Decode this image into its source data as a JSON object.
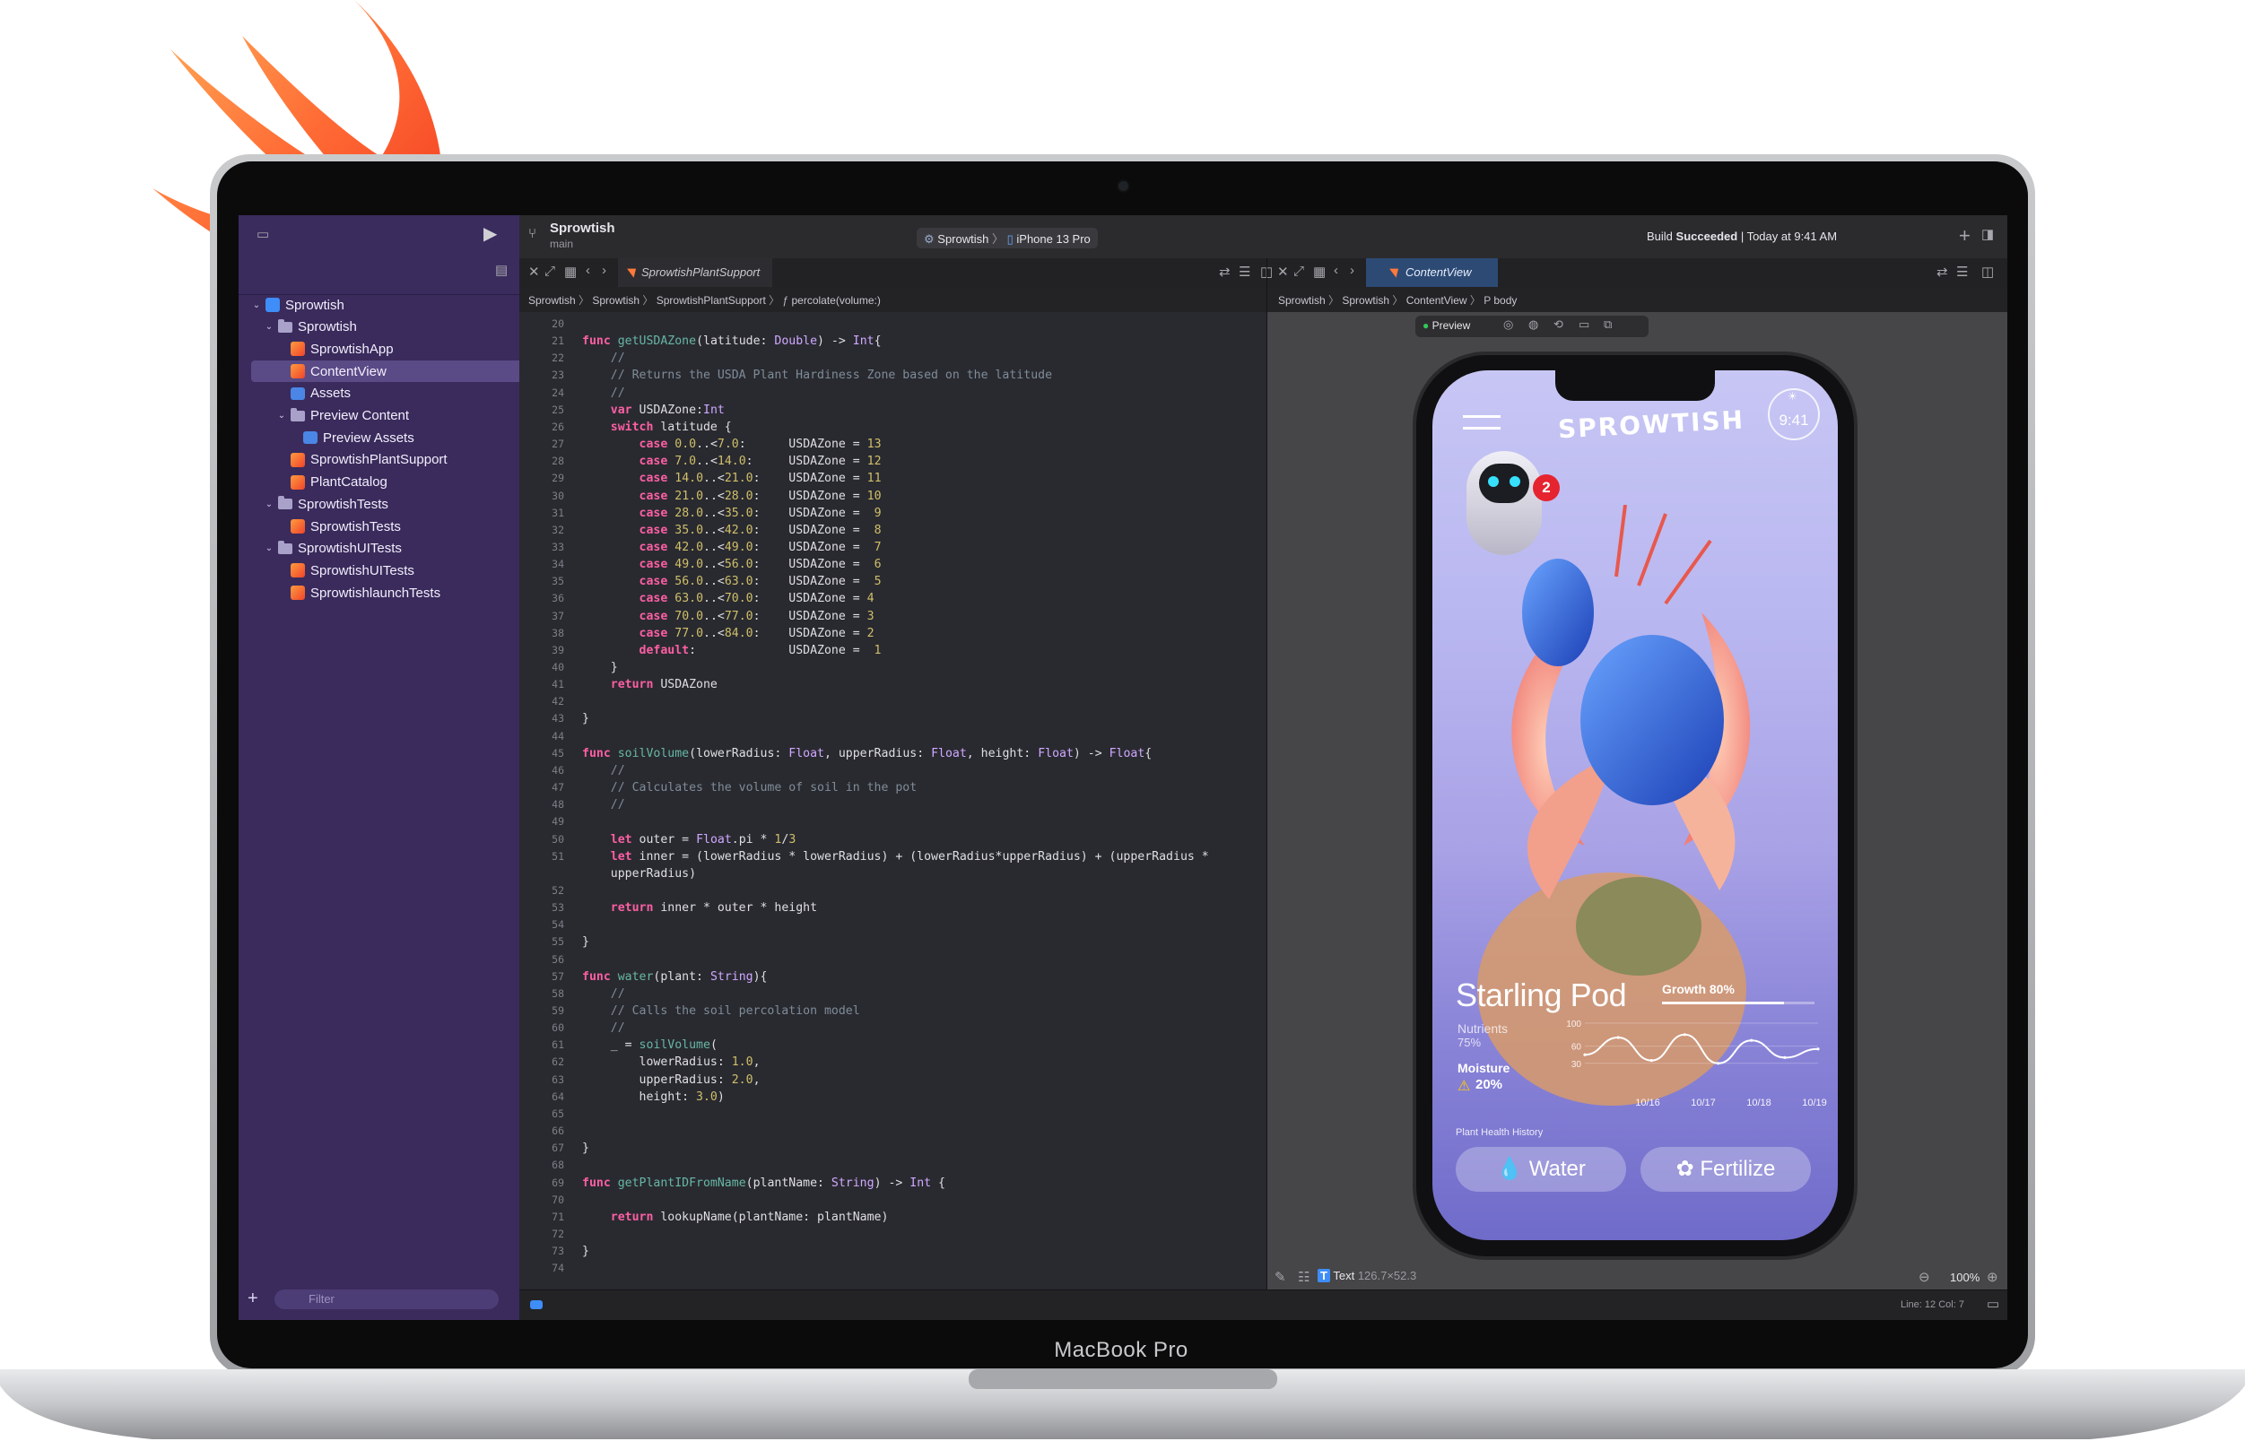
{
  "device": {
    "brand_label": "MacBook Pro"
  },
  "toolbar": {
    "project": "Sprowtish",
    "branch": "main",
    "scheme": "Sprowtish",
    "device": "iPhone 13 Pro",
    "status_prefix": "Build",
    "status_bold": "Succeeded",
    "status_suffix": "| Today at 9:41 AM"
  },
  "navigator": {
    "filter_placeholder": "Filter",
    "items": [
      {
        "label": "Sprowtish",
        "icon": "app-icon",
        "indent": 0,
        "chev": "v"
      },
      {
        "label": "Sprowtish",
        "icon": "folder-icon",
        "indent": 1,
        "chev": "v"
      },
      {
        "label": "SprowtishApp",
        "icon": "swift-file-icon",
        "indent": 2,
        "chev": ""
      },
      {
        "label": "ContentView",
        "icon": "swift-file-icon",
        "indent": 2,
        "chev": "",
        "selected": true
      },
      {
        "label": "Assets",
        "icon": "asset-catalog-icon",
        "indent": 2,
        "chev": ""
      },
      {
        "label": "Preview Content",
        "icon": "folder-icon",
        "indent": 2,
        "chev": "v"
      },
      {
        "label": "Preview Assets",
        "icon": "asset-catalog-icon",
        "indent": 3,
        "chev": ""
      },
      {
        "label": "SprowtishPlantSupport",
        "icon": "swift-file-icon",
        "indent": 2,
        "chev": ""
      },
      {
        "label": "PlantCatalog",
        "icon": "swift-file-icon",
        "indent": 2,
        "chev": ""
      },
      {
        "label": "SprowtishTests",
        "icon": "folder-icon",
        "indent": 1,
        "chev": "v"
      },
      {
        "label": "SprowtishTests",
        "icon": "swift-file-icon",
        "indent": 2,
        "chev": ""
      },
      {
        "label": "SprowtishUITests",
        "icon": "folder-icon",
        "indent": 1,
        "chev": "v"
      },
      {
        "label": "SprowtishUITests",
        "icon": "swift-file-icon",
        "indent": 2,
        "chev": ""
      },
      {
        "label": "SprowtishlaunchTests",
        "icon": "swift-file-icon",
        "indent": 2,
        "chev": ""
      }
    ]
  },
  "editor_left": {
    "tab": "SprowtishPlantSupport",
    "breadcrumb": [
      "Sprowtish",
      "Sprowtish",
      "SprowtishPlantSupport",
      "percolate(volume:)"
    ]
  },
  "editor_right": {
    "tab": "ContentView",
    "breadcrumb": [
      "Sprowtish",
      "Sprowtish",
      "ContentView",
      "body"
    ],
    "preview_label": "Preview",
    "inspector_text": "Text",
    "inspector_size": "126.7×52.3",
    "zoom": "100%",
    "cursor": "Line: 12  Col: 7"
  },
  "code": [
    {
      "n": "20",
      "t": ""
    },
    {
      "n": "21",
      "t": "func getUSDAZone(latitude: Double) -> Int{"
    },
    {
      "n": "22",
      "t": "    //"
    },
    {
      "n": "23",
      "t": "    // Returns the USDA Plant Hardiness Zone based on the latitude"
    },
    {
      "n": "24",
      "t": "    //"
    },
    {
      "n": "25",
      "t": "    var USDAZone:Int"
    },
    {
      "n": "26",
      "t": "    switch latitude {"
    },
    {
      "n": "27",
      "t": "        case 0.0..<7.0:      USDAZone = 13"
    },
    {
      "n": "28",
      "t": "        case 7.0..<14.0:     USDAZone = 12"
    },
    {
      "n": "29",
      "t": "        case 14.0..<21.0:    USDAZone = 11"
    },
    {
      "n": "30",
      "t": "        case 21.0..<28.0:    USDAZone = 10"
    },
    {
      "n": "31",
      "t": "        case 28.0..<35.0:    USDAZone =  9"
    },
    {
      "n": "32",
      "t": "        case 35.0..<42.0:    USDAZone =  8"
    },
    {
      "n": "33",
      "t": "        case 42.0..<49.0:    USDAZone =  7"
    },
    {
      "n": "34",
      "t": "        case 49.0..<56.0:    USDAZone =  6"
    },
    {
      "n": "35",
      "t": "        case 56.0..<63.0:    USDAZone =  5"
    },
    {
      "n": "36",
      "t": "        case 63.0..<70.0:    USDAZone = 4"
    },
    {
      "n": "37",
      "t": "        case 70.0..<77.0:    USDAZone = 3"
    },
    {
      "n": "38",
      "t": "        case 77.0..<84.0:    USDAZone = 2"
    },
    {
      "n": "39",
      "t": "        default:             USDAZone =  1"
    },
    {
      "n": "40",
      "t": "    }"
    },
    {
      "n": "41",
      "t": "    return USDAZone"
    },
    {
      "n": "42",
      "t": ""
    },
    {
      "n": "43",
      "t": "}"
    },
    {
      "n": "44",
      "t": ""
    },
    {
      "n": "45",
      "t": "func soilVolume(lowerRadius: Float, upperRadius: Float, height: Float) -> Float{"
    },
    {
      "n": "46",
      "t": "    //"
    },
    {
      "n": "47",
      "t": "    // Calculates the volume of soil in the pot"
    },
    {
      "n": "48",
      "t": "    //"
    },
    {
      "n": "49",
      "t": ""
    },
    {
      "n": "50",
      "t": "    let outer = Float.pi * 1/3"
    },
    {
      "n": "51",
      "t": "    let inner = (lowerRadius * lowerRadius) + (lowerRadius*upperRadius) + (upperRadius *"
    },
    {
      "n": "",
      "t": "    upperRadius)"
    },
    {
      "n": "52",
      "t": ""
    },
    {
      "n": "53",
      "t": "    return inner * outer * height"
    },
    {
      "n": "54",
      "t": ""
    },
    {
      "n": "55",
      "t": "}"
    },
    {
      "n": "56",
      "t": ""
    },
    {
      "n": "57",
      "t": "func water(plant: String){"
    },
    {
      "n": "58",
      "t": "    //"
    },
    {
      "n": "59",
      "t": "    // Calls the soil percolation model"
    },
    {
      "n": "60",
      "t": "    //"
    },
    {
      "n": "61",
      "t": "    _ = soilVolume("
    },
    {
      "n": "62",
      "t": "        lowerRadius: 1.0,"
    },
    {
      "n": "63",
      "t": "        upperRadius: 2.0,"
    },
    {
      "n": "64",
      "t": "        height: 3.0)"
    },
    {
      "n": "65",
      "t": ""
    },
    {
      "n": "66",
      "t": ""
    },
    {
      "n": "67",
      "t": "}"
    },
    {
      "n": "68",
      "t": ""
    },
    {
      "n": "69",
      "t": "func getPlantIDFromName(plantName: String) -> Int {"
    },
    {
      "n": "70",
      "t": ""
    },
    {
      "n": "71",
      "t": "    return lookupName(plantName: plantName)"
    },
    {
      "n": "72",
      "t": ""
    },
    {
      "n": "73",
      "t": "}"
    },
    {
      "n": "74",
      "t": ""
    }
  ],
  "app": {
    "time": "9:41",
    "logo_text": "SPROWTISH",
    "badge_count": "2",
    "plant_name": "Starling Pod",
    "growth_label": "Growth 80%",
    "growth": 0.8,
    "nutrients_label": "Nutrients",
    "nutrients_value": "75%",
    "moisture_label": "Moisture",
    "moisture_value": "20%",
    "history_label": "Plant Health History",
    "water_button": "Water",
    "fertilize_button": "Fertilize",
    "colors": {
      "accent": "#ffffff",
      "badge": "#e5242f",
      "warning": "#ffcc00"
    }
  },
  "chart_data": {
    "type": "line",
    "x": [
      "10/16",
      "10/17",
      "10/18",
      "10/19"
    ],
    "y_ticks": [
      "100",
      "60",
      "30"
    ],
    "ylim": [
      0,
      100
    ],
    "series": [
      {
        "values": [
          45,
          75,
          35,
          80,
          30,
          70,
          40,
          55
        ]
      }
    ]
  }
}
